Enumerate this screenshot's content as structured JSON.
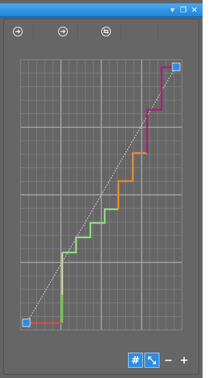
{
  "titlebar": {
    "menu_icon": "dropdown-arrow-icon",
    "restore_icon": "restore-window-icon",
    "close_icon": "close-icon",
    "menu_glyph": "▾",
    "restore_glyph": "❐",
    "close_glyph": "✕"
  },
  "toolbar": {
    "buttons": [
      {
        "icon": "arrow-right-circle-icon",
        "glyph": "➜"
      },
      {
        "icon": "arrow-right-circle-icon",
        "glyph": "➜"
      },
      {
        "icon": "swap-circle-icon",
        "glyph": "⇆"
      }
    ]
  },
  "curve": {
    "description_colors": {
      "grid_major": "#a9a9a9",
      "grid_minor": "#8a8a8a",
      "segment_red": "#e04848",
      "segment_green": "#6fd033",
      "segment_light_green": "#8fe080",
      "segment_orange": "#e88a33",
      "segment_magenta": "#b0187a",
      "endpoint": "#2f8de0"
    }
  },
  "bottombar": {
    "grid_toggle_glyph": "#",
    "diagonal_toggle_glyph": "⤡",
    "minus_glyph": "−",
    "plus_glyph": "+"
  }
}
